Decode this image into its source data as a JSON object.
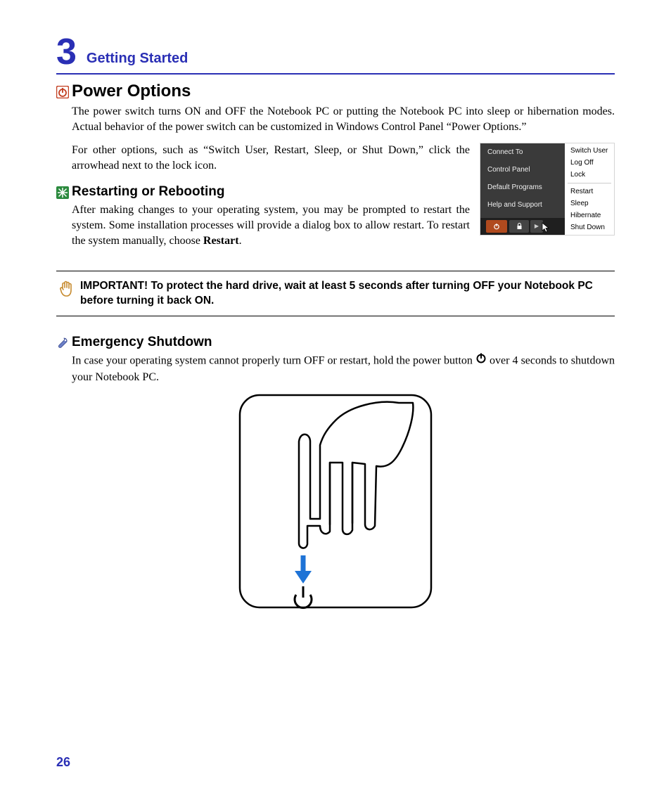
{
  "chapter": {
    "number": "3",
    "title": "Getting Started"
  },
  "sections": {
    "power_options": {
      "heading": "Power Options",
      "p1": "The power switch turns ON and OFF the Notebook PC or putting the Notebook PC into sleep or hibernation modes. Actual behavior of the power switch can be customized in Windows Control Panel “Power Options.”",
      "p2": "For other options, such as “Switch User, Restart, Sleep, or Shut Down,” click the arrowhead next to the lock icon."
    },
    "restart": {
      "heading": "Restarting or Rebooting",
      "p_before": "After making changes to your operating system, you may be prompted to restart the system. Some installation processes will provide a dialog box to allow restart. To restart the system manually, choose ",
      "p_bold": "Restart",
      "p_after": "."
    },
    "note": {
      "text": "IMPORTANT!  To protect the hard drive, wait at least 5 seconds after turning OFF your Notebook PC before turning it back ON."
    },
    "emergency": {
      "heading": "Emergency Shutdown",
      "p_before": "In case your operating system cannot properly turn OFF or restart, hold the power button ",
      "p_after": " over 4 seconds to shutdown your Notebook PC."
    }
  },
  "screenshot": {
    "left": [
      "Connect To",
      "Control Panel",
      "Default Programs",
      "Help and Support"
    ],
    "right_top": [
      "Switch User",
      "Log Off",
      "Lock"
    ],
    "right_bottom": [
      "Restart",
      "Sleep",
      "Hibernate",
      "Shut Down"
    ]
  },
  "page_number": "26"
}
